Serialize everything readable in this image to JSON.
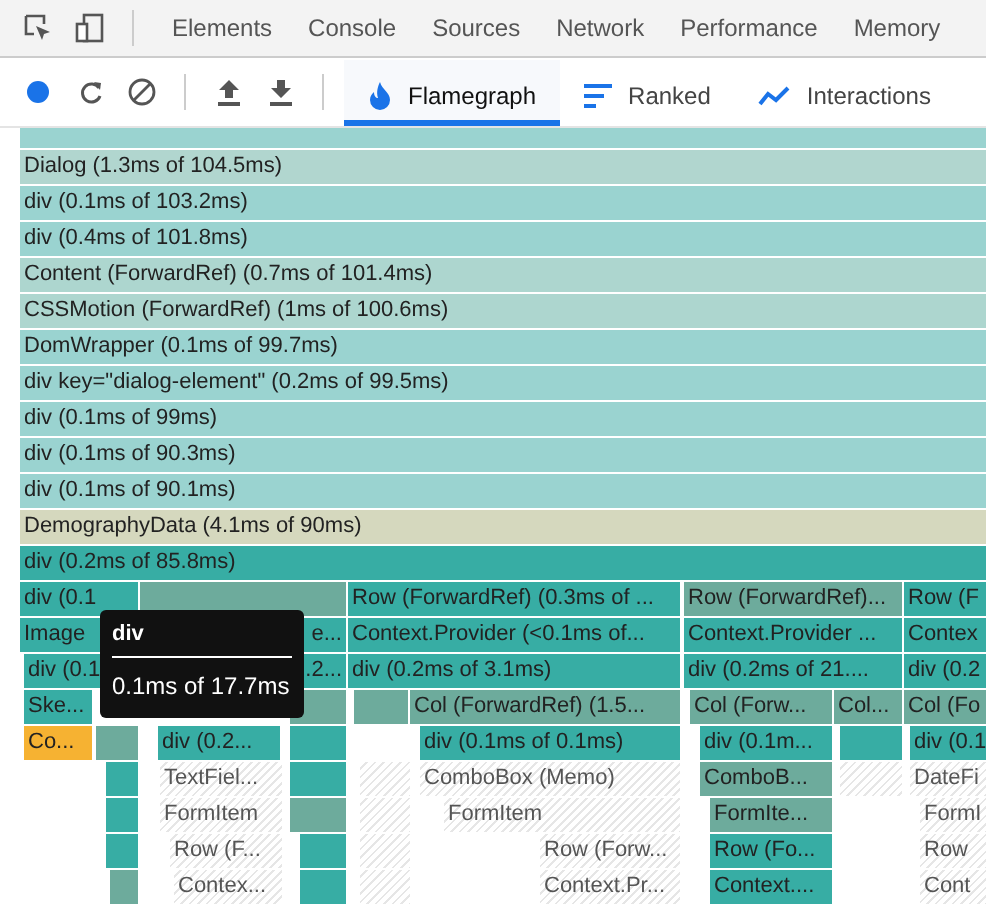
{
  "panel_tabs": [
    {
      "label": "Elements",
      "selected": false
    },
    {
      "label": "Console",
      "selected": false
    },
    {
      "label": "Sources",
      "selected": false
    },
    {
      "label": "Network",
      "selected": false
    },
    {
      "label": "Performance",
      "selected": false
    },
    {
      "label": "Memory",
      "selected": false
    }
  ],
  "recording": true,
  "view_tabs": [
    {
      "label": "Flamegraph",
      "kind": "flame",
      "selected": true
    },
    {
      "label": "Ranked",
      "kind": "ranked",
      "selected": false
    },
    {
      "label": "Interactions",
      "kind": "interactions",
      "selected": false
    }
  ],
  "stack": [
    {
      "color": "#9ad3d0"
    },
    {
      "label": "Dialog (1.3ms of 104.5ms)",
      "color": "#b1d6cf"
    },
    {
      "label": "div (0.1ms of 103.2ms)",
      "color": "#9ad3d0"
    },
    {
      "label": "div (0.4ms of 101.8ms)",
      "color": "#9ad3d0"
    },
    {
      "label": "Content (ForwardRef) (0.7ms of 101.4ms)",
      "color": "#add6cf"
    },
    {
      "label": "CSSMotion (ForwardRef) (1ms of 100.6ms)",
      "color": "#add6cf"
    },
    {
      "label": "DomWrapper (0.1ms of 99.7ms)",
      "color": "#9ad3d0"
    },
    {
      "label": "div key=\"dialog-element\" (0.2ms of 99.5ms)",
      "color": "#9ad3d0"
    },
    {
      "label": "div (0.1ms of 99ms)",
      "color": "#9ad3d0"
    },
    {
      "label": "div (0.1ms of 90.3ms)",
      "color": "#9ad3d0"
    },
    {
      "label": "div (0.1ms of 90.1ms)",
      "color": "#9ad3d0"
    },
    {
      "label": "DemographyData (4.1ms of 90ms)",
      "color": "#d5d8be"
    },
    {
      "label": "div (0.2ms of 85.8ms)",
      "color": "#37ada4"
    }
  ],
  "branches": [
    [
      {
        "label": "div (0.1",
        "color": "#37ada4"
      },
      {
        "color": "#6dab9c"
      },
      {
        "label": "Row (ForwardRef) (0.3ms of ...",
        "color": "#37ada4"
      },
      {
        "label": "Row (ForwardRef)...",
        "color": "#6dab9c"
      },
      {
        "label": "Row (F",
        "color": "#37ada4"
      }
    ],
    [
      {
        "label": "Image",
        "color": "#37ada4"
      },
      {
        "label": "e...",
        "color": "#37ada4"
      },
      {
        "label": "Context.Provider (<0.1ms of...",
        "color": "#37ada4"
      },
      {
        "label": "Context.Provider ...",
        "color": "#37ada4"
      },
      {
        "label": "Contex",
        "color": "#37ada4"
      }
    ],
    [
      {
        "label": "div (0.1",
        "color": "#37ada4"
      },
      {
        "label": ".2...",
        "color": "#37ada4"
      },
      {
        "label": "div (0.2ms of 3.1ms)",
        "color": "#37ada4"
      },
      {
        "label": "div (0.2ms of 21....",
        "color": "#37ada4"
      },
      {
        "label": "div (0.2",
        "color": "#37ada4"
      }
    ],
    [
      {
        "label": "Ske...",
        "color": "#37ada4"
      },
      {
        "color": "#6dab9c"
      },
      {
        "color": "#6dab9c"
      },
      {
        "label": "Col (ForwardRef) (1.5...",
        "color": "#6dab9c"
      },
      {
        "label": "Col (Forw...",
        "color": "#6dab9c"
      },
      {
        "label": "Col...",
        "color": "#6dab9c"
      },
      {
        "label": "Col (Fo",
        "color": "#6dab9c"
      }
    ],
    [
      {
        "label": "Co...",
        "color": "#f6b232"
      },
      {
        "color": "#6dab9c"
      },
      {
        "label": "div (0.2...",
        "color": "#37ada4"
      },
      {
        "color": "#37ada4"
      },
      {
        "label": "div (0.1ms of 0.1ms)",
        "color": "#37ada4"
      },
      {
        "label": "div (0.1m...",
        "color": "#37ada4"
      },
      {
        "color": "#37ada4"
      },
      {
        "label": "div (0.1",
        "color": "#37ada4"
      }
    ],
    [
      {
        "color": "#37ada4"
      },
      {
        "label": "TextFiel...",
        "kind": "hatched"
      },
      {
        "color": "#37ada4"
      },
      {
        "kind": "hatched"
      },
      {
        "label": "ComboBox (Memo)",
        "kind": "hatched"
      },
      {
        "label": "ComboB...",
        "color": "#6dab9c"
      },
      {
        "kind": "hatched"
      },
      {
        "label": "DateFi",
        "kind": "hatched"
      }
    ],
    [
      {
        "color": "#37ada4"
      },
      {
        "label": "FormItem",
        "kind": "hatched"
      },
      {
        "color": "#6dab9c"
      },
      {
        "kind": "hatched"
      },
      {
        "label": "FormItem",
        "kind": "hatched"
      },
      {
        "label": "FormIte...",
        "color": "#6dab9c"
      },
      {
        "label": "FormI",
        "kind": "hatched"
      }
    ],
    [
      {
        "color": "#37ada4"
      },
      {
        "label": "Row (F...",
        "kind": "hatched"
      },
      {
        "color": "#37ada4"
      },
      {
        "kind": "hatched"
      },
      {
        "label": "Row (Forw...",
        "kind": "hatched"
      },
      {
        "label": "Row (Fo...",
        "color": "#37ada4"
      },
      {
        "label": "Row",
        "kind": "hatched"
      }
    ],
    [
      {
        "color": "#6dab9c"
      },
      {
        "label": "Contex...",
        "kind": "hatched"
      },
      {
        "color": "#37ada4"
      },
      {
        "kind": "hatched"
      },
      {
        "label": "Context.Pr...",
        "kind": "hatched"
      },
      {
        "label": "Context....",
        "color": "#37ada4"
      },
      {
        "label": "Cont",
        "kind": "hatched"
      }
    ]
  ],
  "tooltip": {
    "title": "div",
    "detail": "0.1ms of 17.7ms"
  }
}
